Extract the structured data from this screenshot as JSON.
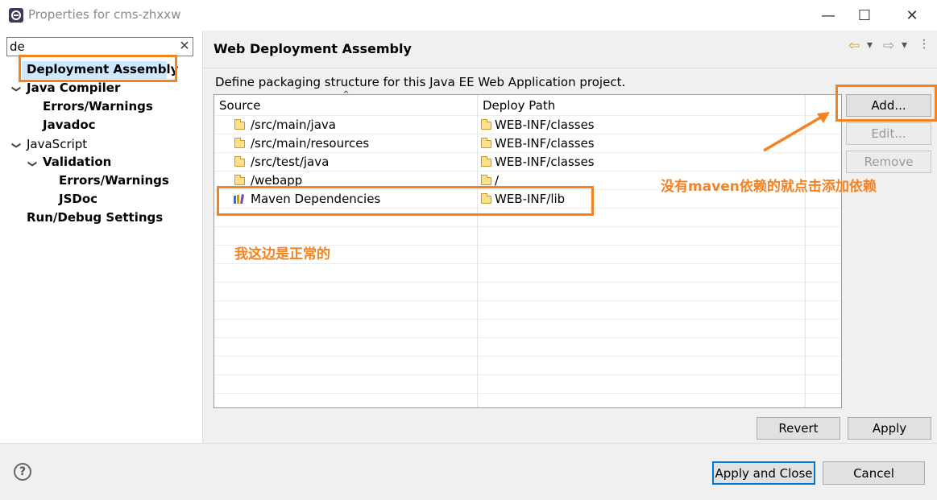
{
  "window": {
    "title": "Properties for cms-zhxxw",
    "minimize_glyph": "—",
    "maximize_glyph": "☐",
    "close_glyph": "✕"
  },
  "filter": {
    "value": "de",
    "clear_glyph": "✕"
  },
  "tree": {
    "items": [
      {
        "label": "Deployment Assembly",
        "selected": true
      },
      {
        "label": "Java Compiler",
        "expanded": true
      },
      {
        "label": "Errors/Warnings"
      },
      {
        "label": "Javadoc"
      },
      {
        "label": "JavaScript",
        "expanded": true
      },
      {
        "label": "Validation",
        "expanded": true
      },
      {
        "label": "Errors/Warnings"
      },
      {
        "label": "JSDoc"
      },
      {
        "label": "Run/Debug Settings"
      }
    ]
  },
  "page": {
    "title": "Web Deployment Assembly",
    "description": "Define packaging structure for this Java EE Web Application project.",
    "nav": {
      "back": "⇦",
      "dropdown": "▾",
      "forward": "⇨",
      "menu": "⋮"
    }
  },
  "table": {
    "columns": [
      "Source",
      "Deploy Path"
    ],
    "sort_indicator": "⌃",
    "rows": [
      {
        "source": "/src/main/java",
        "deploy_path": "WEB-INF/classes",
        "icon": "folder-icon"
      },
      {
        "source": "/src/main/resources",
        "deploy_path": "WEB-INF/classes",
        "icon": "folder-icon"
      },
      {
        "source": "/src/test/java",
        "deploy_path": "WEB-INF/classes",
        "icon": "folder-icon"
      },
      {
        "source": "/webapp",
        "deploy_path": "/",
        "icon": "folder-icon"
      },
      {
        "source": "Maven Dependencies",
        "deploy_path": "WEB-INF/lib",
        "icon": "library-icon"
      }
    ]
  },
  "side_buttons": {
    "add": "Add...",
    "edit": "Edit...",
    "remove": "Remove"
  },
  "page_buttons": {
    "revert": "Revert",
    "apply": "Apply"
  },
  "dialog_buttons": {
    "apply_close": "Apply and Close",
    "cancel": "Cancel"
  },
  "help": {
    "glyph": "?"
  },
  "annotations": {
    "note_add": "没有maven依赖的就点击添加依赖",
    "note_normal": "我这边是正常的",
    "color": "#f58220"
  }
}
